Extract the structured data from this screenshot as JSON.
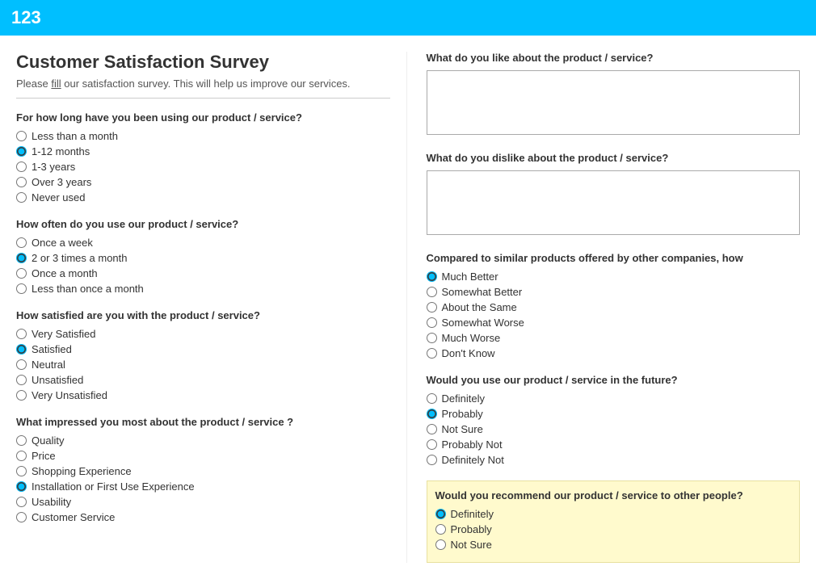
{
  "header": {
    "logo": "123"
  },
  "survey": {
    "title": "Customer Satisfaction Survey",
    "subtitle_pre": "Please ",
    "subtitle_fill": "fill",
    "subtitle_post": " our satisfaction survey. This will help us improve our services."
  },
  "questions": {
    "q1": {
      "label": "For how long have you been using our product / service?",
      "options": [
        "Less than a month",
        "1-12 months",
        "1-3 years",
        "Over 3 years",
        "Never used"
      ],
      "selected": "1-12 months"
    },
    "q2": {
      "label": "How often do you use our product / service?",
      "options": [
        "Once a week",
        "2 or 3 times a month",
        "Once a month",
        "Less than once a month"
      ],
      "selected": "2 or 3 times a month"
    },
    "q3": {
      "label": "How satisfied are you with the product / service?",
      "options": [
        "Very Satisfied",
        "Satisfied",
        "Neutral",
        "Unsatisfied",
        "Very Unsatisfied"
      ],
      "selected": "Satisfied"
    },
    "q4": {
      "label": "What impressed you most about the product / service ?",
      "options": [
        "Quality",
        "Price",
        "Shopping Experience",
        "Installation or First Use Experience",
        "Usability",
        "Customer Service"
      ],
      "selected": "Installation or First Use Experience"
    }
  },
  "right_questions": {
    "q_like": {
      "label": "What do you like about the product / service?"
    },
    "q_dislike": {
      "label": "What do you dislike about the product / service?"
    },
    "q_compare": {
      "label": "Compared to similar products offered by other companies, how",
      "options": [
        "Much Better",
        "Somewhat Better",
        "About the Same",
        "Somewhat Worse",
        "Much Worse",
        "Don't Know"
      ],
      "selected": "Much Better"
    },
    "q_future": {
      "label": "Would you use our product / service in the future?",
      "options": [
        "Definitely",
        "Probably",
        "Not Sure",
        "Probably Not",
        "Definitely Not"
      ],
      "selected": "Probably"
    },
    "q_recommend": {
      "label": "Would you recommend our product / service to other people?",
      "options": [
        "Definitely",
        "Probably",
        "Not Sure"
      ],
      "selected": "Definitely"
    }
  }
}
